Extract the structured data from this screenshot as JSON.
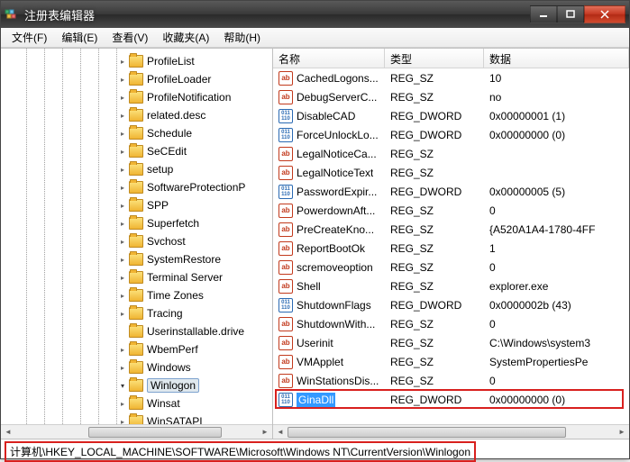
{
  "titlebar": {
    "title": "注册表编辑器"
  },
  "menu": {
    "file": "文件(F)",
    "edit": "编辑(E)",
    "view": "查看(V)",
    "favorites": "收藏夹(A)",
    "help": "帮助(H)"
  },
  "tree": {
    "items": [
      {
        "label": "ProfileList",
        "indent": 0
      },
      {
        "label": "ProfileLoader",
        "indent": 0
      },
      {
        "label": "ProfileNotification",
        "indent": 0
      },
      {
        "label": "related.desc",
        "indent": 0
      },
      {
        "label": "Schedule",
        "indent": 0
      },
      {
        "label": "SeCEdit",
        "indent": 0
      },
      {
        "label": "setup",
        "indent": 0
      },
      {
        "label": "SoftwareProtectionP",
        "indent": 0
      },
      {
        "label": "SPP",
        "indent": 0
      },
      {
        "label": "Superfetch",
        "indent": 0
      },
      {
        "label": "Svchost",
        "indent": 0
      },
      {
        "label": "SystemRestore",
        "indent": 0
      },
      {
        "label": "Terminal Server",
        "indent": 0
      },
      {
        "label": "Time Zones",
        "indent": 0
      },
      {
        "label": "Tracing",
        "indent": 0
      },
      {
        "label": "Userinstallable.drive",
        "indent": 0,
        "noexp": true
      },
      {
        "label": "WbemPerf",
        "indent": 0
      },
      {
        "label": "Windows",
        "indent": 0
      },
      {
        "label": "Winlogon",
        "indent": 0,
        "selected": true,
        "expanded": true
      },
      {
        "label": "Winsat",
        "indent": 0
      },
      {
        "label": "WinSATAPI",
        "indent": 0
      }
    ]
  },
  "list": {
    "headers": {
      "name": "名称",
      "type": "类型",
      "data": "数据"
    },
    "rows": [
      {
        "name": "CachedLogons...",
        "type": "REG_SZ",
        "data": "10",
        "icon": "sz"
      },
      {
        "name": "DebugServerC...",
        "type": "REG_SZ",
        "data": "no",
        "icon": "sz"
      },
      {
        "name": "DisableCAD",
        "type": "REG_DWORD",
        "data": "0x00000001 (1)",
        "icon": "dw"
      },
      {
        "name": "ForceUnlockLo...",
        "type": "REG_DWORD",
        "data": "0x00000000 (0)",
        "icon": "dw"
      },
      {
        "name": "LegalNoticeCa...",
        "type": "REG_SZ",
        "data": "",
        "icon": "sz"
      },
      {
        "name": "LegalNoticeText",
        "type": "REG_SZ",
        "data": "",
        "icon": "sz"
      },
      {
        "name": "PasswordExpir...",
        "type": "REG_DWORD",
        "data": "0x00000005 (5)",
        "icon": "dw"
      },
      {
        "name": "PowerdownAft...",
        "type": "REG_SZ",
        "data": "0",
        "icon": "sz"
      },
      {
        "name": "PreCreateKno...",
        "type": "REG_SZ",
        "data": "{A520A1A4-1780-4FF",
        "icon": "sz"
      },
      {
        "name": "ReportBootOk",
        "type": "REG_SZ",
        "data": "1",
        "icon": "sz"
      },
      {
        "name": "scremoveoption",
        "type": "REG_SZ",
        "data": "0",
        "icon": "sz"
      },
      {
        "name": "Shell",
        "type": "REG_SZ",
        "data": "explorer.exe",
        "icon": "sz"
      },
      {
        "name": "ShutdownFlags",
        "type": "REG_DWORD",
        "data": "0x0000002b (43)",
        "icon": "dw"
      },
      {
        "name": "ShutdownWith...",
        "type": "REG_SZ",
        "data": "0",
        "icon": "sz"
      },
      {
        "name": "Userinit",
        "type": "REG_SZ",
        "data": "C:\\Windows\\system3",
        "icon": "sz"
      },
      {
        "name": "VMApplet",
        "type": "REG_SZ",
        "data": "SystemPropertiesPe",
        "icon": "sz"
      },
      {
        "name": "WinStationsDis...",
        "type": "REG_SZ",
        "data": "0",
        "icon": "sz"
      },
      {
        "name": "GinaDll",
        "type": "REG_DWORD",
        "data": "0x00000000 (0)",
        "icon": "dw",
        "selected": true,
        "highlighted": true
      }
    ]
  },
  "statusbar": {
    "path": "计算机\\HKEY_LOCAL_MACHINE\\SOFTWARE\\Microsoft\\Windows NT\\CurrentVersion\\Winlogon"
  },
  "iconText": {
    "sz": "ab",
    "dw": "011\n110"
  }
}
